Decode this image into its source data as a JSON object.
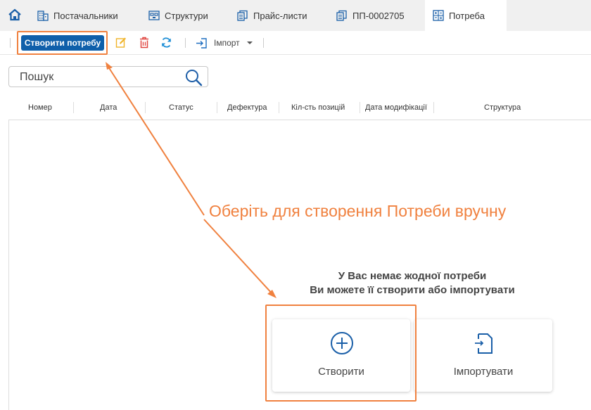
{
  "tabs": [
    {
      "label": "Постачальники",
      "icon": "building-icon"
    },
    {
      "label": "Структури",
      "icon": "structure-icon"
    },
    {
      "label": "Прайс-листи",
      "icon": "document-stack-icon"
    },
    {
      "label": "ПП-0002705",
      "icon": "document-stack-icon"
    },
    {
      "label": "Потреба",
      "icon": "calculator-icon",
      "active": true
    }
  ],
  "toolbar": {
    "create_label": "Створити потребу",
    "import_label": "Імпорт"
  },
  "search": {
    "placeholder": "Пошук"
  },
  "columns": [
    "Номер",
    "Дата",
    "Статус",
    "Дефектура",
    "Кіл-сть позицій",
    "Дата модифікації",
    "Структура"
  ],
  "annotation": "Оберіть для створення Потреби вручну",
  "empty_state": {
    "line1": "У Вас немає жодної потреби",
    "line2": "Ви можете її створити або імпортувати",
    "create_label": "Створити",
    "import_label": "Імпортувати"
  },
  "colors": {
    "accent": "#0f5faa",
    "annotation": "#f0813f",
    "edit": "#f0b429",
    "delete": "#e0443f",
    "refresh": "#1f8fd6"
  }
}
